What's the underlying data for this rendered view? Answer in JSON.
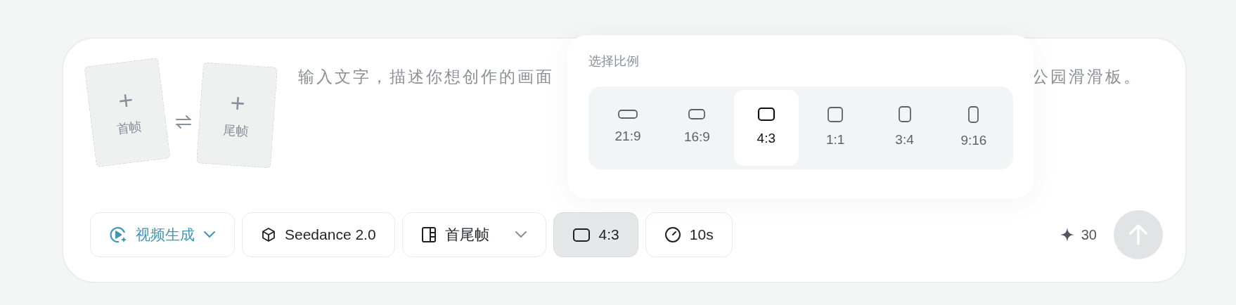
{
  "frames": [
    {
      "plus": "+",
      "label": "首帧"
    },
    {
      "plus": "+",
      "label": "尾帧"
    }
  ],
  "prompt": {
    "placeholder_start": "输入文字，描述你想创作的画面",
    "placeholder_end": "公园滑滑板。"
  },
  "ratio_popup": {
    "title": "选择比例",
    "options": [
      {
        "label": "21:9",
        "kind": "ultrawide",
        "selected": false
      },
      {
        "label": "16:9",
        "kind": "wide",
        "selected": false
      },
      {
        "label": "4:3",
        "kind": "landscape",
        "selected": true
      },
      {
        "label": "1:1",
        "kind": "square",
        "selected": false
      },
      {
        "label": "3:4",
        "kind": "portrait",
        "selected": false
      },
      {
        "label": "9:16",
        "kind": "tall",
        "selected": false
      }
    ]
  },
  "toolbar": [
    {
      "label": "视频生成",
      "kind": "mode",
      "dropdown": true,
      "selected": false
    },
    {
      "label": "Seedance 2.0",
      "kind": "model",
      "dropdown": false,
      "selected": false
    },
    {
      "label": "首尾帧",
      "kind": "frames",
      "dropdown": true,
      "selected": false
    },
    {
      "label": "4:3",
      "kind": "ratio",
      "dropdown": false,
      "selected": true
    },
    {
      "label": "10s",
      "kind": "duration",
      "dropdown": false,
      "selected": false
    }
  ],
  "credits": "30"
}
